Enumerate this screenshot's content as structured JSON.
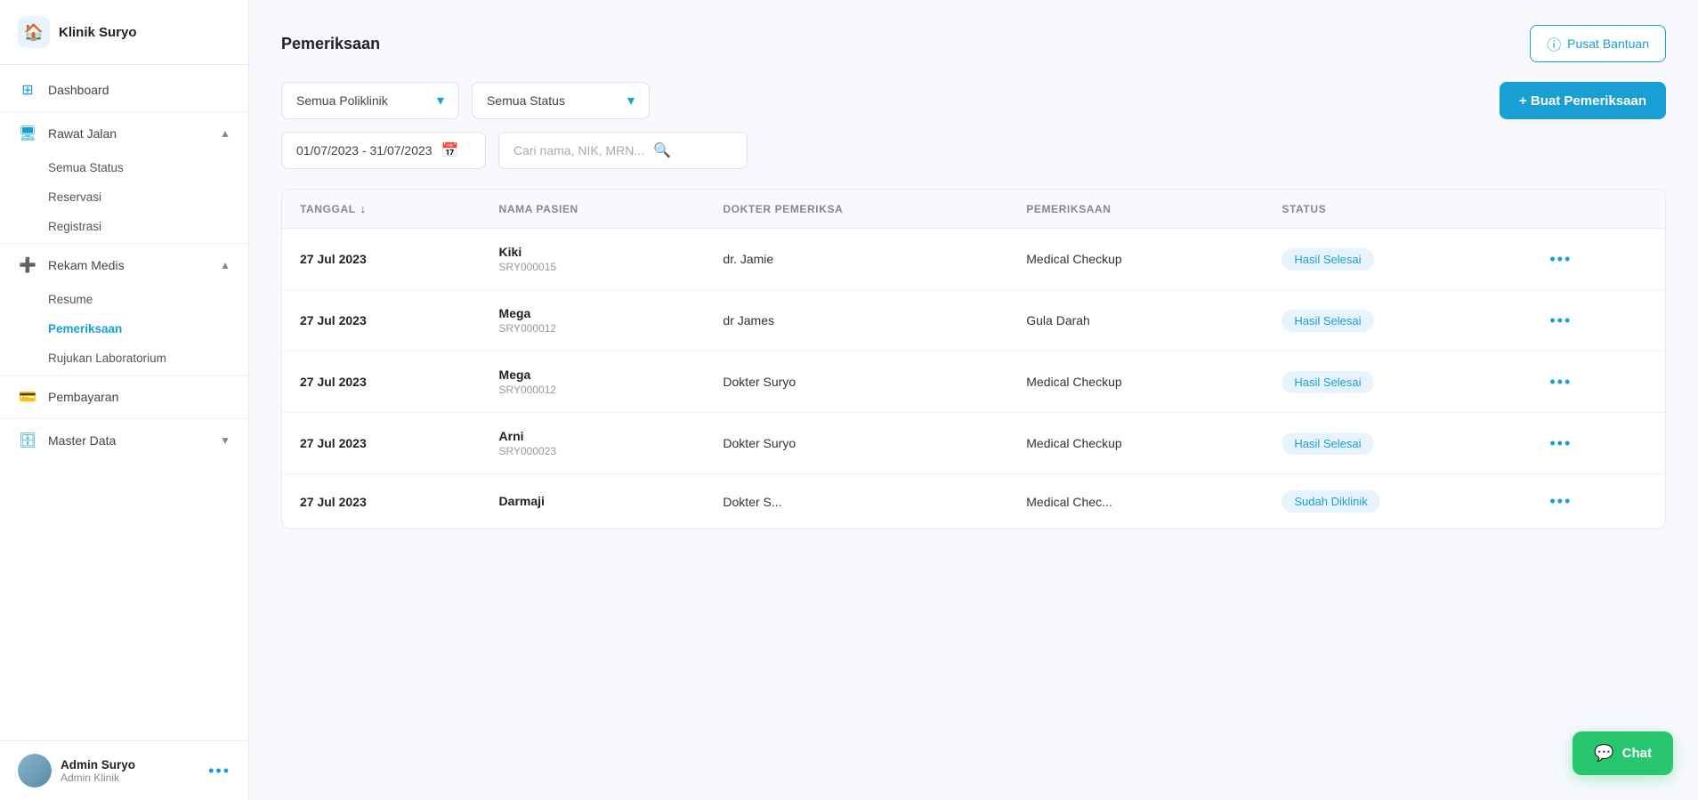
{
  "app": {
    "name": "Klinik Suryo"
  },
  "sidebar": {
    "logo_icon": "🏠",
    "nav_items": [
      {
        "id": "dashboard",
        "label": "Dashboard",
        "icon": "⊞",
        "has_sub": false
      },
      {
        "id": "rawat-jalan",
        "label": "Rawat Jalan",
        "icon": "🖥",
        "has_sub": true,
        "expanded": true,
        "sub_items": [
          {
            "id": "semua-status",
            "label": "Semua Status",
            "active": false
          },
          {
            "id": "reservasi",
            "label": "Reservasi",
            "active": false
          },
          {
            "id": "registrasi",
            "label": "Registrasi",
            "active": false
          }
        ]
      },
      {
        "id": "rekam-medis",
        "label": "Rekam Medis",
        "icon": "➕",
        "has_sub": true,
        "expanded": true,
        "sub_items": [
          {
            "id": "resume",
            "label": "Resume",
            "active": false
          },
          {
            "id": "pemeriksaan",
            "label": "Pemeriksaan",
            "active": true
          },
          {
            "id": "rujukan-lab",
            "label": "Rujukan Laboratorium",
            "active": false
          }
        ]
      },
      {
        "id": "pembayaran",
        "label": "Pembayaran",
        "icon": "💳",
        "has_sub": false
      },
      {
        "id": "master-data",
        "label": "Master Data",
        "icon": "🗄",
        "has_sub": true,
        "expanded": false
      }
    ],
    "footer": {
      "name": "Admin Suryo",
      "role": "Admin Klinik",
      "dots": "•••"
    }
  },
  "main": {
    "page_title": "Pemeriksaan",
    "help_button": "Pusat Bantuan",
    "filters": {
      "poliklinik": {
        "label": "Semua Poliklinik",
        "options": [
          "Semua Poliklinik"
        ]
      },
      "status": {
        "label": "Semua Status",
        "options": [
          "Semua Status"
        ]
      }
    },
    "create_button": "+ Buat Pemeriksaan",
    "date_range": "01/07/2023 - 31/07/2023",
    "search_placeholder": "Cari nama, NIK, MRN...",
    "table": {
      "columns": [
        {
          "id": "tanggal",
          "label": "TANGGAL",
          "sortable": true
        },
        {
          "id": "nama-pasien",
          "label": "NAMA PASIEN",
          "sortable": false
        },
        {
          "id": "dokter",
          "label": "DOKTER PEMERIKSA",
          "sortable": false
        },
        {
          "id": "pemeriksaan",
          "label": "PEMERIKSAAN",
          "sortable": false
        },
        {
          "id": "status",
          "label": "STATUS",
          "sortable": false
        }
      ],
      "rows": [
        {
          "tanggal": "27 Jul 2023",
          "nama": "Kiki",
          "id_pasien": "SRY000015",
          "dokter": "dr. Jamie",
          "pemeriksaan": "Medical Checkup",
          "status": "Hasil Selesai",
          "status_class": "status-selesai"
        },
        {
          "tanggal": "27 Jul 2023",
          "nama": "Mega",
          "id_pasien": "SRY000012",
          "dokter": "dr James",
          "pemeriksaan": "Gula Darah",
          "status": "Hasil Selesai",
          "status_class": "status-selesai"
        },
        {
          "tanggal": "27 Jul 2023",
          "nama": "Mega",
          "id_pasien": "SRY000012",
          "dokter": "Dokter Suryo",
          "pemeriksaan": "Medical Checkup",
          "status": "Hasil Selesai",
          "status_class": "status-selesai"
        },
        {
          "tanggal": "27 Jul 2023",
          "nama": "Arni",
          "id_pasien": "SRY000023",
          "dokter": "Dokter Suryo",
          "pemeriksaan": "Medical Checkup",
          "status": "Hasil Selesai",
          "status_class": "status-selesai"
        },
        {
          "tanggal": "27 Jul 2023",
          "nama": "Darmaji",
          "id_pasien": "",
          "dokter": "Dokter S...",
          "pemeriksaan": "Medical Chec...",
          "status": "Sudah Diklinik",
          "status_class": "status-diklinik"
        }
      ]
    }
  },
  "chat": {
    "label": "Chat",
    "icon": "💬"
  }
}
